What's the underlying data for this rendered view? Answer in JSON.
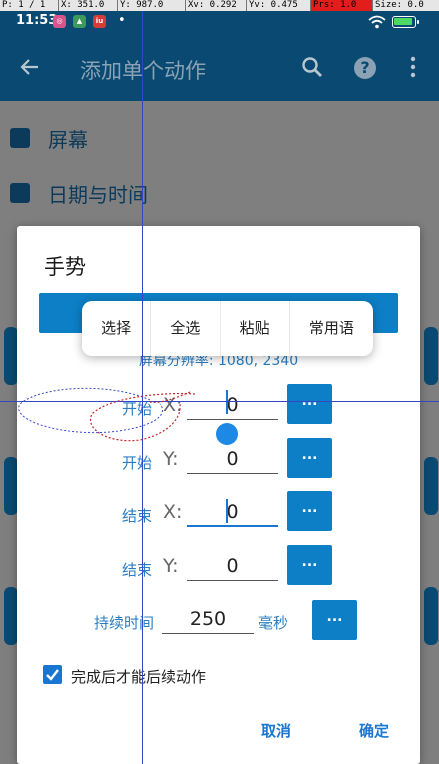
{
  "debug": {
    "pointer": "P: 1 / 1",
    "x": "X: 351.0",
    "y": "Y: 987.0",
    "xv": "Xv: 0.292",
    "yv": "Yv: 0.475",
    "prs": "Prs: 1.0",
    "size": "Size: 0.0"
  },
  "status": {
    "time": "11:53",
    "notif_1": "◎",
    "notif_2": "▲",
    "notif_3": "iu",
    "dot": "•"
  },
  "appbar": {
    "title": "添加单个动作"
  },
  "background_list": {
    "item_1": "屏幕",
    "item_2": "日期与时间"
  },
  "dialog": {
    "title": "手势",
    "resolution": "屏幕分辨率: 1080, 2340",
    "rows": [
      {
        "label": "开始",
        "axis": "X:",
        "value": "0",
        "button": "..."
      },
      {
        "label": "开始",
        "axis": "Y:",
        "value": "0",
        "button": "..."
      },
      {
        "label": "结束",
        "axis": "X:",
        "value": "0",
        "button": "..."
      },
      {
        "label": "结束",
        "axis": "Y:",
        "value": "0",
        "button": "..."
      }
    ],
    "duration": {
      "label": "持续时间",
      "value": "250",
      "unit": "毫秒",
      "button": "..."
    },
    "checkbox": {
      "label": "完成后才能后续动作",
      "checked": true
    },
    "cancel": "取消",
    "ok": "确定"
  },
  "context_menu": {
    "items": [
      "选择",
      "全选",
      "粘贴",
      "常用语"
    ]
  },
  "colors": {
    "appbar": "#0a4a72",
    "accent": "#0c7fc6",
    "label": "#2a7ec0",
    "pressure": "#e31c1c"
  }
}
